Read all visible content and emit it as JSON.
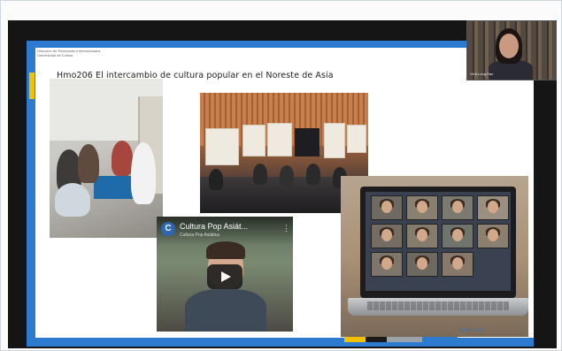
{
  "slide": {
    "header_small": [
      "Dirección de Relaciones Internacionales",
      "Universidad de Colima"
    ],
    "title": "Hmo206 El intercambio de cultura popular en el Noreste de Asia",
    "footer_url": "www.uco.",
    "strip_colors": [
      "#f2c200",
      "#1a1a1a",
      "#9aa3aa",
      "#2c7bd0"
    ]
  },
  "video_embed": {
    "channel_initial": "C",
    "title": "Cultura Pop Asiát...",
    "channel_name": "Cultura Pop Asiática",
    "more_icon": "⋮"
  },
  "participant": {
    "name": "Vinh Long Han"
  },
  "colors": {
    "slide_frame": "#2c7bd0",
    "accent_yellow": "#f2c200",
    "screen_background": "#151515"
  }
}
